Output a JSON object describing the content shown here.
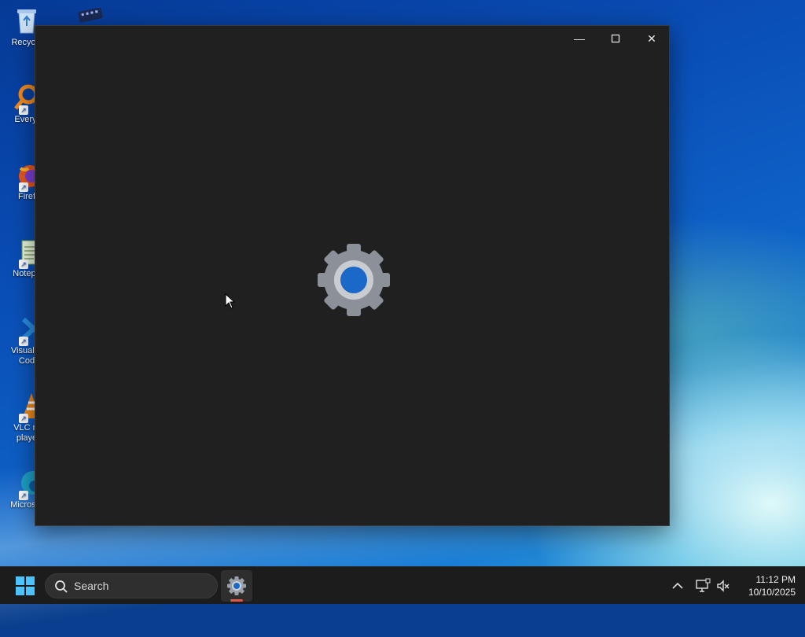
{
  "desktop": {
    "icons": [
      {
        "label": "Recycle",
        "color": "#8fb9e6"
      },
      {
        "label": "Everyt",
        "color": "#f28a1e"
      },
      {
        "label": "Firef",
        "color": "#e8571f"
      },
      {
        "label": "Notepa",
        "color": "#7bbf4a"
      },
      {
        "label": "Visual S Cod",
        "color": "#2a8fe0"
      },
      {
        "label": "VLC m playe",
        "color": "#f08a1a"
      },
      {
        "label": "Microsof",
        "color": "#1ea3c9"
      }
    ]
  },
  "window": {
    "minimize_glyph": "—",
    "maximize_glyph": "☐",
    "close_glyph": "✕",
    "splash_icon": "settings-gear-icon",
    "background": "#202020"
  },
  "taskbar": {
    "search_placeholder": "Search",
    "pinned_app_icon": "settings-gear-icon",
    "tray": {
      "overflow_icon": "chevron-up-icon",
      "network_icon": "network-icon",
      "volume_icon": "volume-muted-icon"
    },
    "clock_time": "11:12 PM",
    "clock_date": "10/10/2025"
  },
  "colors": {
    "accent": "#1a68c8",
    "gear_gray": "#8c9199",
    "indicator": "#e0574b"
  }
}
